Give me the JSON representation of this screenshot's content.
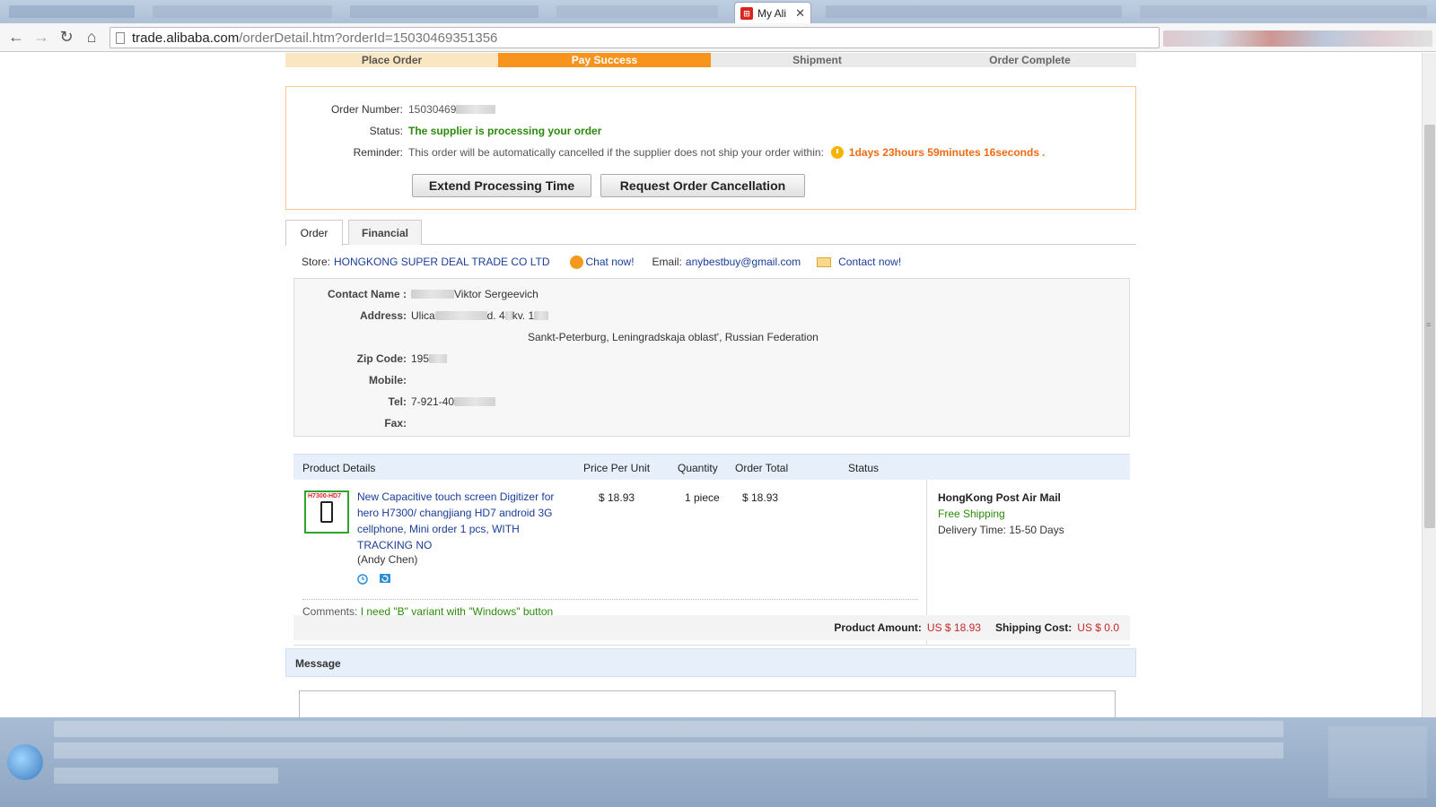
{
  "browser": {
    "tab_title": "My Ali",
    "favicon": "alibaba-cart-icon",
    "url_host": "trade.alibaba.com",
    "url_path": "/orderDetail.htm?orderId=15030469351356"
  },
  "progress": {
    "steps": [
      "Place Order",
      "Pay Success",
      "Shipment",
      "Order Complete"
    ],
    "current_index": 1
  },
  "order_status": {
    "number_label": "Order Number:",
    "number_value": "15030469",
    "status_label": "Status:",
    "status_value": "The supplier is processing your order",
    "reminder_label": "Reminder:",
    "reminder_text": "This order will be automatically cancelled if the supplier does not ship your order within:",
    "countdown": "1days 23hours 59minutes 16seconds",
    "countdown_end": ".",
    "extend_button": "Extend Processing Time",
    "cancel_button": "Request Order Cancellation"
  },
  "tabs": [
    "Order",
    "Financial"
  ],
  "store": {
    "label": "Store:",
    "name": "HONGKONG SUPER DEAL TRADE CO LTD",
    "chat": "Chat now!",
    "email_label": "Email:",
    "email": "anybestbuy@gmail.com",
    "contact": "Contact now!"
  },
  "address": {
    "contact_label": "Contact Name :",
    "contact_value": "Viktor Sergeevich",
    "address_label": "Address:",
    "address_line1_a": "Ulica",
    "address_line1_b": "d. 4",
    "address_line1_c": "kv. 1",
    "address_line2": "Sankt-Peterburg, Leningradskaja oblast', Russian Federation",
    "zip_label": "Zip Code:",
    "zip_value": "195",
    "mobile_label": "Mobile:",
    "tel_label": "Tel:",
    "tel_value": "7-921-40",
    "fax_label": "Fax:"
  },
  "table": {
    "headers": [
      "Product Details",
      "Price Per Unit",
      "Quantity",
      "Order Total",
      "Status"
    ],
    "product_title": "New Capacitive touch screen Digitizer for hero H7300/ changjiang HD7 android 3G cellphone, Mini order 1 pcs, WITH TRACKING NO",
    "seller": "(Andy Chen)",
    "thumb_tag": "H7300-HD7",
    "price": "$ 18.93",
    "quantity": "1 piece",
    "total": "$ 18.93",
    "shipping_method": "HongKong Post Air Mail",
    "shipping_cost_text": "Free Shipping",
    "delivery_label": "Delivery Time:",
    "delivery_value": "15-50 Days",
    "comments_label": "Comments:",
    "comments_value": "I need \"B\" variant with \"Windows\" button"
  },
  "totals": {
    "product_amount_label": "Product Amount:",
    "product_amount": "US $ 18.93",
    "shipping_label": "Shipping Cost:",
    "shipping_value": "US $ 0.0"
  },
  "message": {
    "heading": "Message"
  },
  "colors": {
    "accent_orange": "#f7941d",
    "status_green": "#2a8a0a",
    "countdown_orange": "#f06a12",
    "link_blue": "#1a3e9a",
    "price_red": "#c8282a"
  }
}
